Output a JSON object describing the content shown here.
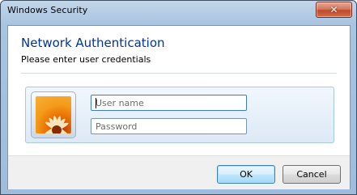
{
  "window": {
    "title": "Windows Security",
    "close_glyph": "✕"
  },
  "header": {
    "title": "Network Authentication",
    "subtitle": "Please enter user credentials"
  },
  "credentials": {
    "avatar_icon": "user-tile-flower-icon",
    "username": {
      "value": "",
      "placeholder": "User name"
    },
    "password": {
      "value": "",
      "placeholder": "Password"
    }
  },
  "buttons": {
    "ok_label": "OK",
    "cancel_label": "Cancel"
  },
  "colors": {
    "title_accent": "#003399",
    "focus_border": "#3d7bbf",
    "close_button": "#c24a2a"
  }
}
